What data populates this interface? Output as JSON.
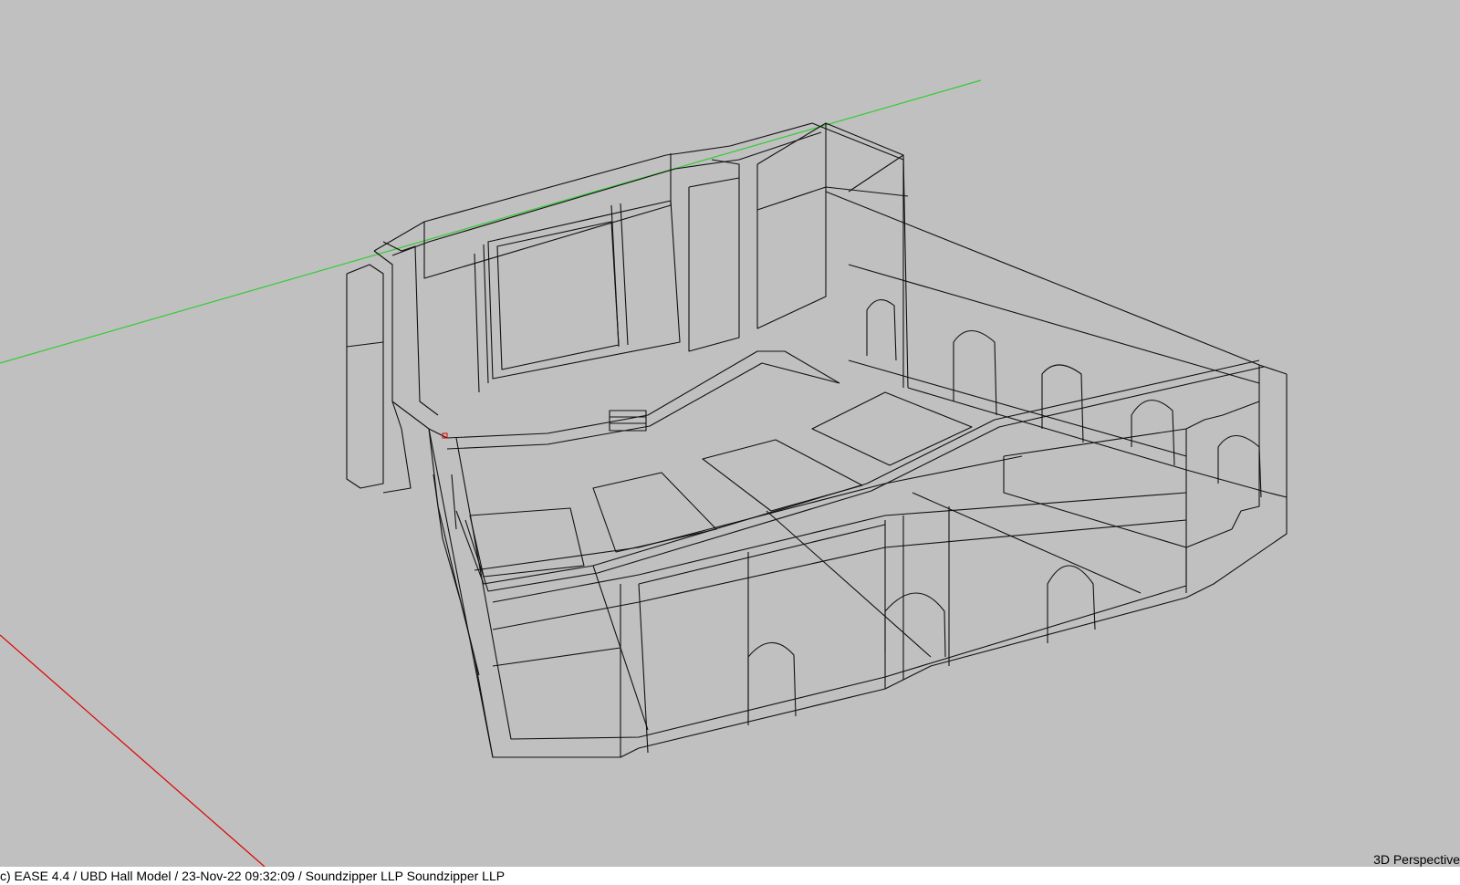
{
  "viewport": {
    "view_mode": "3D Perspective",
    "background_color": "#c0c0c0",
    "wire_color": "#111111",
    "axis_colors": {
      "x": "#dd0000",
      "y": "#33cc33"
    }
  },
  "status_bar": {
    "text": "c) EASE 4.4  / UBD Hall Model  / 23-Nov-22 09:32:09 / Soundzipper LLP Soundzipper LLP"
  }
}
